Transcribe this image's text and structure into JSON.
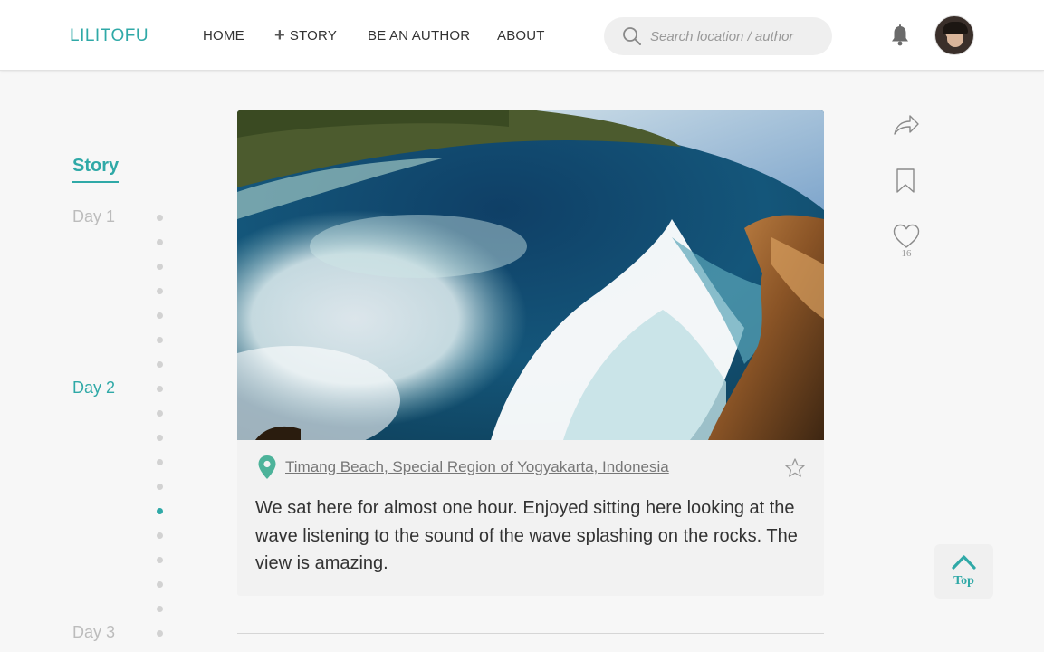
{
  "header": {
    "logo": "LILITOFU",
    "nav": {
      "home": "HOME",
      "story": "STORY",
      "be_an_author": "BE AN AUTHOR",
      "about": "ABOUT"
    },
    "search": {
      "placeholder": "Search location / author",
      "value": ""
    },
    "icons": {
      "search": "search-icon",
      "bell": "bell-icon",
      "avatar": "user-avatar"
    }
  },
  "sidebar": {
    "title": "Story",
    "days": [
      {
        "label": "Day 1",
        "active": false
      },
      {
        "label": "Day 2",
        "active": true
      },
      {
        "label": "Day 3",
        "active": false
      }
    ],
    "timeline_dot_count": 18,
    "active_dot_index": 12
  },
  "post": {
    "image_alt": "Waves crashing against rocky cliffs",
    "location": "Timang Beach, Special Region of Yogyakarta, Indonesia",
    "description": "We sat here for almost one hour. Enjoyed sitting here looking at the wave listening to the sound of the wave splashing on the rocks. The view is amazing."
  },
  "actions": {
    "likes": "16",
    "icons": [
      "share-icon",
      "bookmark-icon",
      "heart-icon",
      "star-icon"
    ]
  },
  "top_button": {
    "label": "Top"
  },
  "colors": {
    "accent": "#2fa9a7",
    "background": "#f7f7f7",
    "muted_text": "#bcbcbc"
  }
}
